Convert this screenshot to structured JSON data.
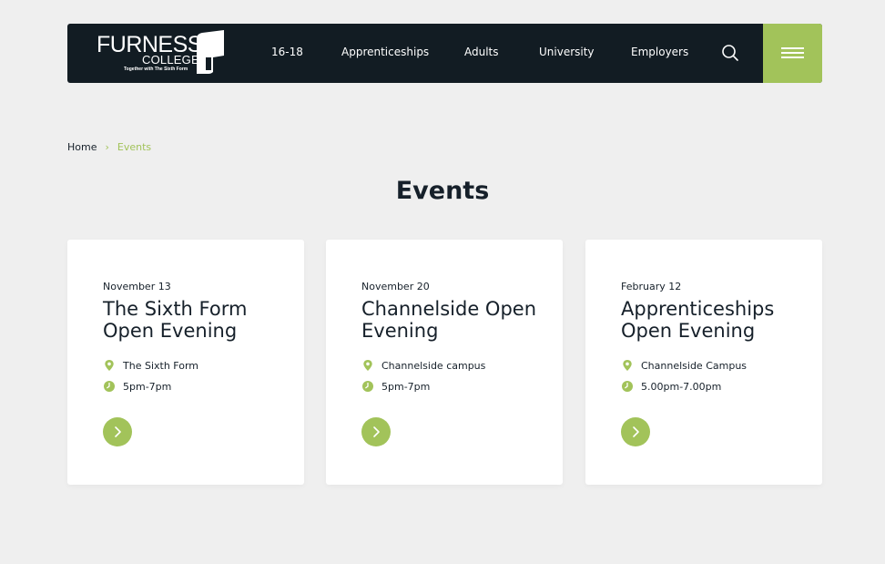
{
  "header": {
    "logo": {
      "name": "FURNESS",
      "sub": "COLLEGE",
      "tagline": "Together with The Sixth Form"
    },
    "nav": [
      {
        "label": "16-18"
      },
      {
        "label": "Apprenticeships"
      },
      {
        "label": "Adults"
      },
      {
        "label": "University"
      },
      {
        "label": "Employers"
      }
    ],
    "search_icon": "search-icon",
    "menu_icon": "hamburger-icon"
  },
  "breadcrumb": {
    "home": "Home",
    "separator": "›",
    "current": "Events"
  },
  "page": {
    "title": "Events"
  },
  "events": [
    {
      "date": "November 13",
      "title": "The Sixth Form Open Evening",
      "location": "The Sixth Form",
      "time": "5pm-7pm"
    },
    {
      "date": "November 20",
      "title": "Channelside Open Evening",
      "location": "Channelside campus",
      "time": "5pm-7pm"
    },
    {
      "date": "February 12",
      "title": "Apprenticeships Open Evening",
      "location": "Channelside Campus",
      "time": "5.00pm-7.00pm"
    }
  ],
  "colors": {
    "accent": "#a2c35a",
    "dark": "#121c23",
    "background": "#efefef"
  }
}
